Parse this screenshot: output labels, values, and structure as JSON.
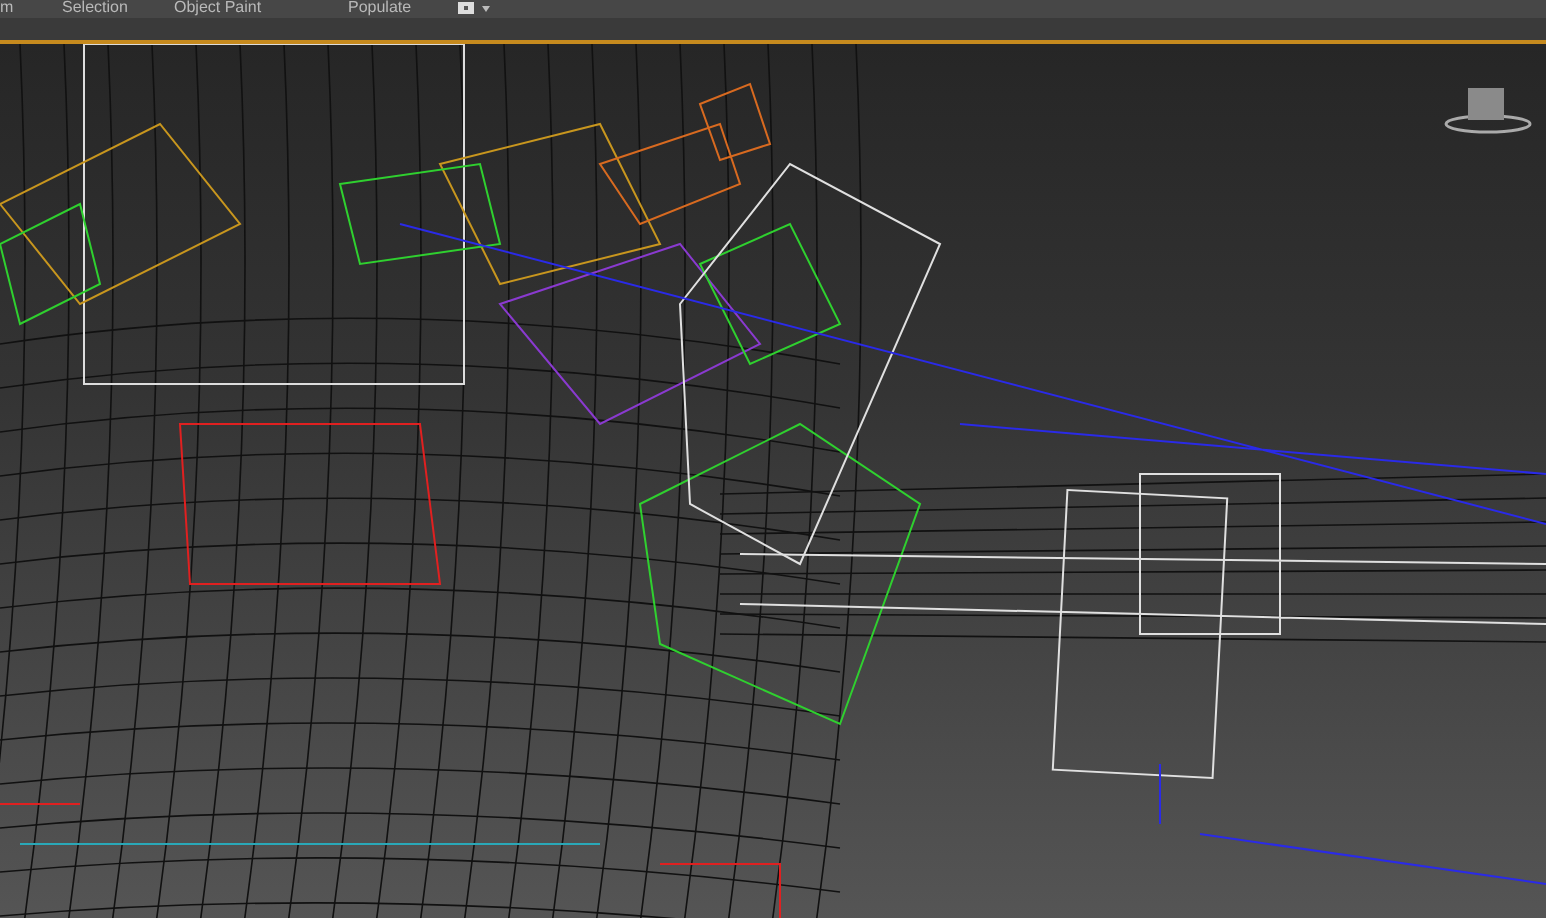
{
  "ribbon": {
    "tabs": [
      {
        "label": "m"
      },
      {
        "label": "Selection"
      },
      {
        "label": "Object Paint"
      },
      {
        "label": "Populate"
      }
    ]
  }
}
